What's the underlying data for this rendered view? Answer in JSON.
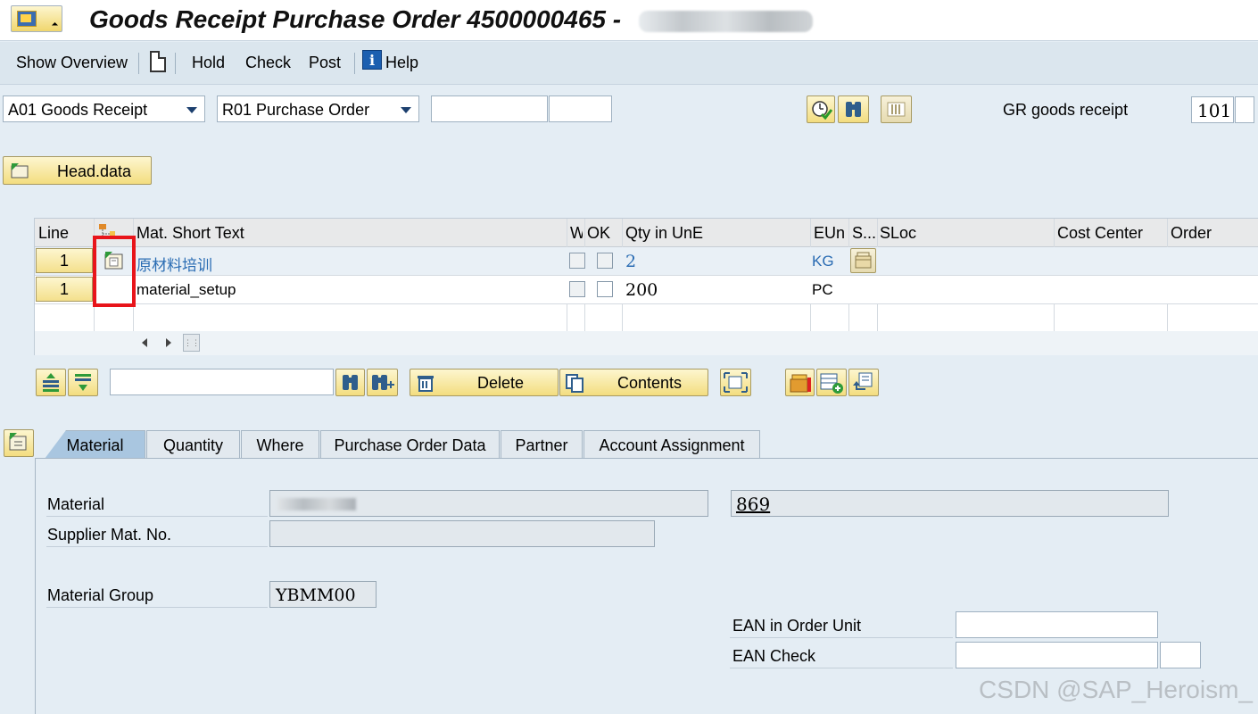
{
  "window": {
    "title": "Goods Receipt Purchase Order 4500000465 -"
  },
  "toolbar": {
    "show_overview": "Show Overview",
    "hold": "Hold",
    "check": "Check",
    "post": "Post",
    "help": "Help"
  },
  "header": {
    "action_select": "A01 Goods Receipt",
    "reference_select": "R01 Purchase Order",
    "ref_input_1": "",
    "ref_input_2": "",
    "movement_label": "GR goods receipt",
    "movement_type": "101",
    "head_data_button": "Head.data"
  },
  "grid": {
    "columns": [
      "Line",
      "",
      "Mat. Short Text",
      "W",
      "OK",
      "Qty in UnE",
      "EUn",
      "S...",
      "SLoc",
      "Cost Center",
      "Order"
    ],
    "rows": [
      {
        "line": "1",
        "text": "原材料培训",
        "qty": "2",
        "unit": "KG",
        "ok": false
      },
      {
        "line": "1",
        "text": "material_setup",
        "qty": "200",
        "unit": "PC",
        "ok": false
      }
    ]
  },
  "item_toolbar": {
    "search_value": "",
    "delete": "Delete",
    "contents": "Contents"
  },
  "tabs": [
    "Material",
    "Quantity",
    "Where",
    "Purchase Order Data",
    "Partner",
    "Account Assignment"
  ],
  "detail": {
    "material_label": "Material",
    "material_number": "869",
    "supplier_label": "Supplier Mat. No.",
    "supplier_value": "",
    "group_label": "Material Group",
    "group_value": "YBMM00",
    "ean_unit_label": "EAN in Order Unit",
    "ean_unit_value": "",
    "ean_check_label": "EAN Check",
    "ean_check_value": ""
  },
  "watermark": "CSDN @SAP_Heroism_",
  "colors": {
    "background": "#e4edf4",
    "button_yellow": "#f3dd7f",
    "active_tab": "#a9c6e0",
    "highlight_red": "#e8141a",
    "link_blue": "#2a6cb3"
  }
}
